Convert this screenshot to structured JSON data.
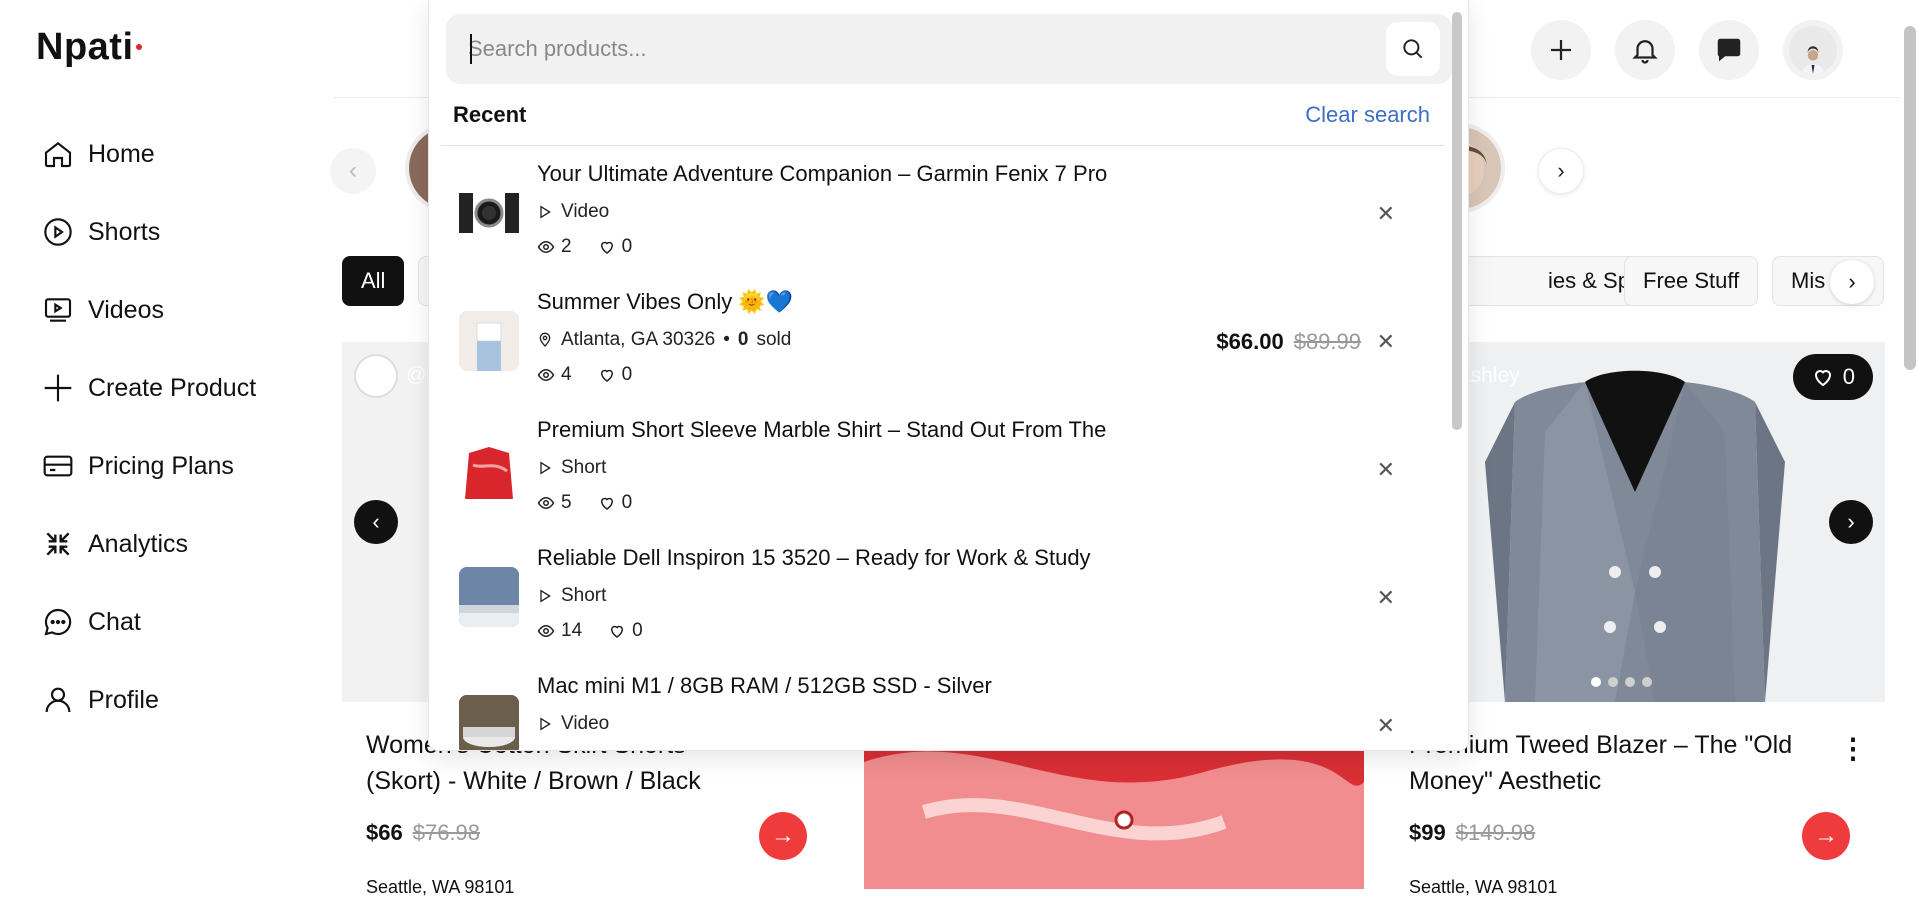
{
  "brand": {
    "name": "Npati"
  },
  "sidebar": {
    "items": [
      {
        "label": "Home",
        "icon": "home-icon"
      },
      {
        "label": "Shorts",
        "icon": "play-circle-icon"
      },
      {
        "label": "Videos",
        "icon": "video-icon"
      },
      {
        "label": "Create Product",
        "icon": "plus-icon"
      },
      {
        "label": "Pricing Plans",
        "icon": "card-icon"
      },
      {
        "label": "Analytics",
        "icon": "analytics-icon"
      },
      {
        "label": "Chat",
        "icon": "chat-icon"
      },
      {
        "label": "Profile",
        "icon": "user-icon"
      }
    ]
  },
  "header": {
    "icons": [
      "plus-icon",
      "bell-icon",
      "message-icon",
      "avatar"
    ]
  },
  "categories": {
    "visible": [
      "All",
      "ies & Sports",
      "Free Stuff",
      "Mis"
    ]
  },
  "search": {
    "placeholder": "Search products...",
    "value": "",
    "recent_label": "Recent",
    "clear_label": "Clear search",
    "items": [
      {
        "title": "Your Ultimate Adventure Companion – Garmin Fenix 7 Pro",
        "type": "Video",
        "views": "2",
        "likes": "0"
      },
      {
        "title": "Summer Vibes Only 🌞💙",
        "location": "Atlanta, GA 30326",
        "sold_count": "0",
        "sold_label": "sold",
        "price": "$66.00",
        "old_price": "$89.99",
        "views": "4",
        "likes": "0"
      },
      {
        "title": "Premium Short Sleeve Marble Shirt – Stand Out From The",
        "type": "Short",
        "views": "5",
        "likes": "0"
      },
      {
        "title": "Reliable Dell Inspiron 15 3520 – Ready for Work & Study",
        "type": "Short",
        "views": "14",
        "likes": "0"
      },
      {
        "title": "Mac mini M1 / 8GB RAM / 512GB SSD - Silver",
        "type": "Video"
      }
    ]
  },
  "cards": [
    {
      "user": "@",
      "title": "Women's Cotton Skirt Shorts (Skort) - White / Brown / Black",
      "title_visible": "Women's Cotton Skirt Shorts (Skort) - White / Brown / Black",
      "price": "$66",
      "old_price": "$76.98",
      "location": "Seattle, WA 98101"
    },
    {
      "title": "",
      "price": ""
    },
    {
      "user": "ashley",
      "likes": "0",
      "title": "Premium Tweed Blazer – The \"Old Money\" Aesthetic",
      "price": "$99",
      "old_price": "$149.98",
      "location": "Seattle, WA 98101"
    }
  ],
  "colors": {
    "accent": "#ef3b3b",
    "link": "#3a6fc7",
    "dark": "#111111"
  }
}
